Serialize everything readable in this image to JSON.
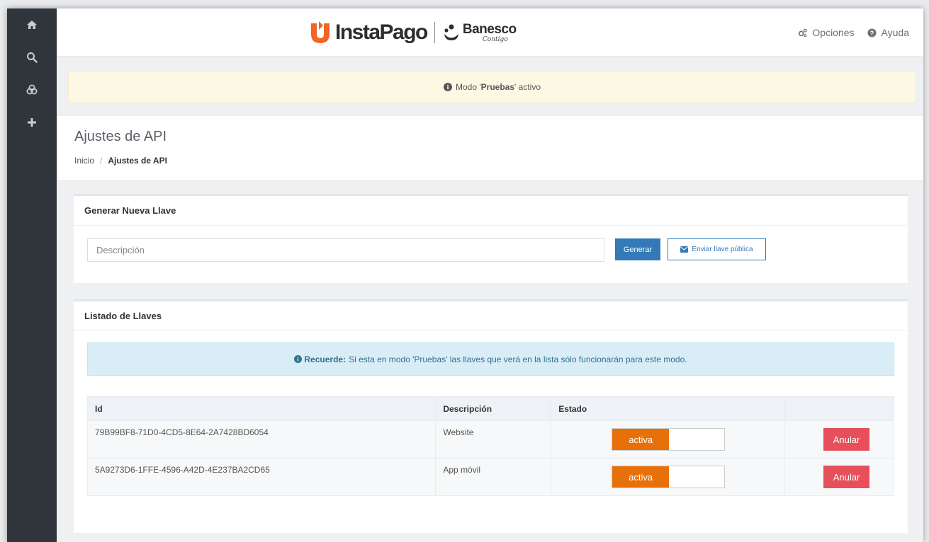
{
  "brand": {
    "insta": "InstaPago",
    "banesco": "Banesco",
    "banesco_sub": "Contigo",
    "accent": "#f26522"
  },
  "sidebar": {
    "items": [
      {
        "icon": "home-icon"
      },
      {
        "icon": "search-icon"
      },
      {
        "icon": "cubes-icon"
      },
      {
        "icon": "plus-icon"
      }
    ]
  },
  "header": {
    "options_label": "Opciones",
    "help_label": "Ayuda"
  },
  "mode_alert": {
    "prefix": "Modo '",
    "mode": "Pruebas",
    "suffix": "' activo"
  },
  "page": {
    "title": "Ajustes de API",
    "breadcrumb": [
      "Inicio",
      "/",
      "Ajustes de API"
    ]
  },
  "generate": {
    "title": "Generar Nueva Llave",
    "placeholder": "Descripción",
    "value": "",
    "generate_label": "Generar",
    "send_label": "Enviar llave pública"
  },
  "keys": {
    "title": "Listado de Llaves",
    "notice_bold": "Recuerde:",
    "notice_text": "Si esta en modo 'Pruebas' las llaves que verá en la lista sólo funcionarán para este modo.",
    "columns": [
      "Id",
      "Descripción",
      "Estado",
      ""
    ],
    "rows": [
      {
        "id": "79B99BF8-71D0-4CD5-8E64-2A7428BD6054",
        "description": "Website",
        "state": "activa",
        "action": "Anular"
      },
      {
        "id": "5A9273D6-1FFE-4596-A42D-4E237BA2CD65",
        "description": "App móvil",
        "state": "activa",
        "action": "Anular"
      }
    ]
  },
  "colors": {
    "toggle_on": "#e8700a",
    "danger": "#e7505a",
    "primary": "#337ab7",
    "sidebar": "#2f353b"
  }
}
